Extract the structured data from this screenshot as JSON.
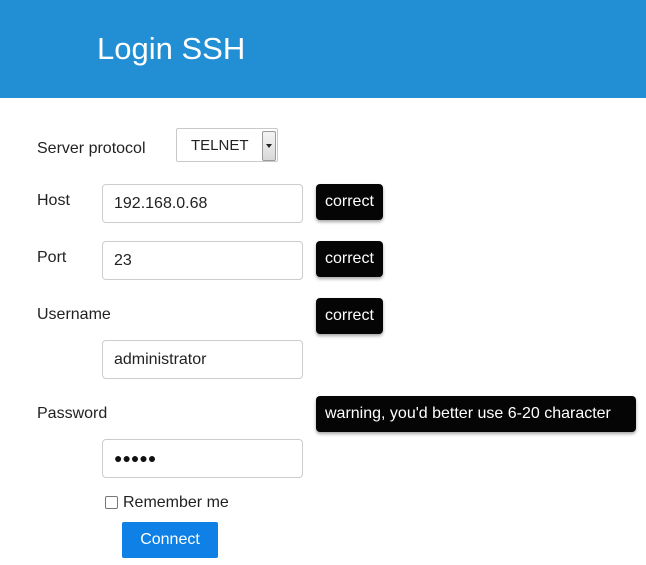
{
  "header": {
    "title": "Login SSH",
    "background_color": "#228ed3"
  },
  "form": {
    "server_protocol": {
      "label": "Server protocol",
      "selected": "TELNET"
    },
    "host": {
      "label": "Host",
      "value": "192.168.0.68",
      "validation": "correct"
    },
    "port": {
      "label": "Port",
      "value": "23",
      "validation": "correct"
    },
    "username": {
      "label": "Username",
      "value": "administrator",
      "validation": "correct"
    },
    "password": {
      "label": "Password",
      "masked_value": "●●●●●",
      "validation": "warning, you'd better use 6-20 character"
    },
    "remember_me": {
      "label": "Remember me",
      "checked": false
    },
    "connect_button": {
      "label": "Connect",
      "color": "#0e80e6"
    }
  },
  "tooltip_color": "#050505"
}
